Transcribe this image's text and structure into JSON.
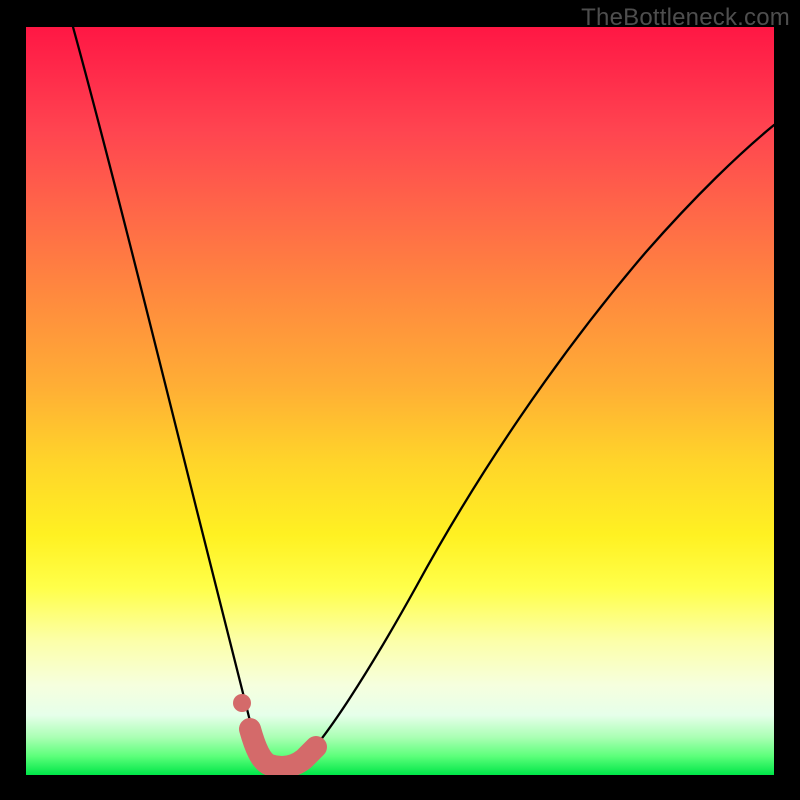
{
  "watermark": "TheBottleneck.com",
  "colors": {
    "background": "#000000",
    "curve": "#000000",
    "marker": "#d46a6a",
    "gradient_top": "#ff1744",
    "gradient_bottom": "#00e648"
  },
  "chart_data": {
    "type": "line",
    "title": "",
    "xlabel": "",
    "ylabel": "",
    "xlim": [
      0,
      100
    ],
    "ylim": [
      0,
      100
    ],
    "series": [
      {
        "name": "bottleneck-curve",
        "x": [
          6,
          10,
          14,
          18,
          22,
          25,
          27,
          29,
          30.5,
          32,
          33.5,
          35,
          38,
          42,
          48,
          55,
          63,
          72,
          82,
          92,
          100
        ],
        "y": [
          100,
          85,
          70,
          55,
          38,
          24,
          15,
          8,
          4,
          1.5,
          0.5,
          0.5,
          1.5,
          5,
          14,
          27,
          41,
          55,
          68,
          79,
          87
        ]
      }
    ],
    "markers": {
      "name": "highlight-segment",
      "x": [
        29.5,
        30.5,
        32,
        33.5,
        35,
        37,
        38.5
      ],
      "y": [
        6,
        3.5,
        1.5,
        1,
        1,
        1.8,
        3.2
      ]
    },
    "marker_dot": {
      "x": 28.5,
      "y": 10
    }
  }
}
